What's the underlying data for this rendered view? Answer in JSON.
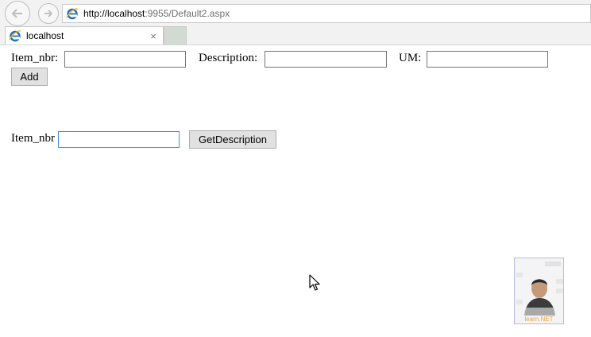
{
  "browser": {
    "url_host": "http://localhost",
    "url_rest": ":9955/Default2.aspx",
    "tab_title": "localhost",
    "tab_close": "×"
  },
  "form": {
    "item_nbr_label": "Item_nbr:",
    "item_nbr_value": "",
    "description_label": "Description:",
    "description_value": "",
    "um_label": "UM:",
    "um_value": "",
    "add_button": "Add",
    "lookup_label": "Item_nbr",
    "lookup_value": "",
    "get_description_button": "GetDescription"
  },
  "overlay": {
    "webcam_caption": "learn.NET"
  },
  "colors": {
    "focus_border": "#3c8fd9",
    "ie_blue": "#1e6fc3",
    "ie_gold": "#f2b51d"
  }
}
